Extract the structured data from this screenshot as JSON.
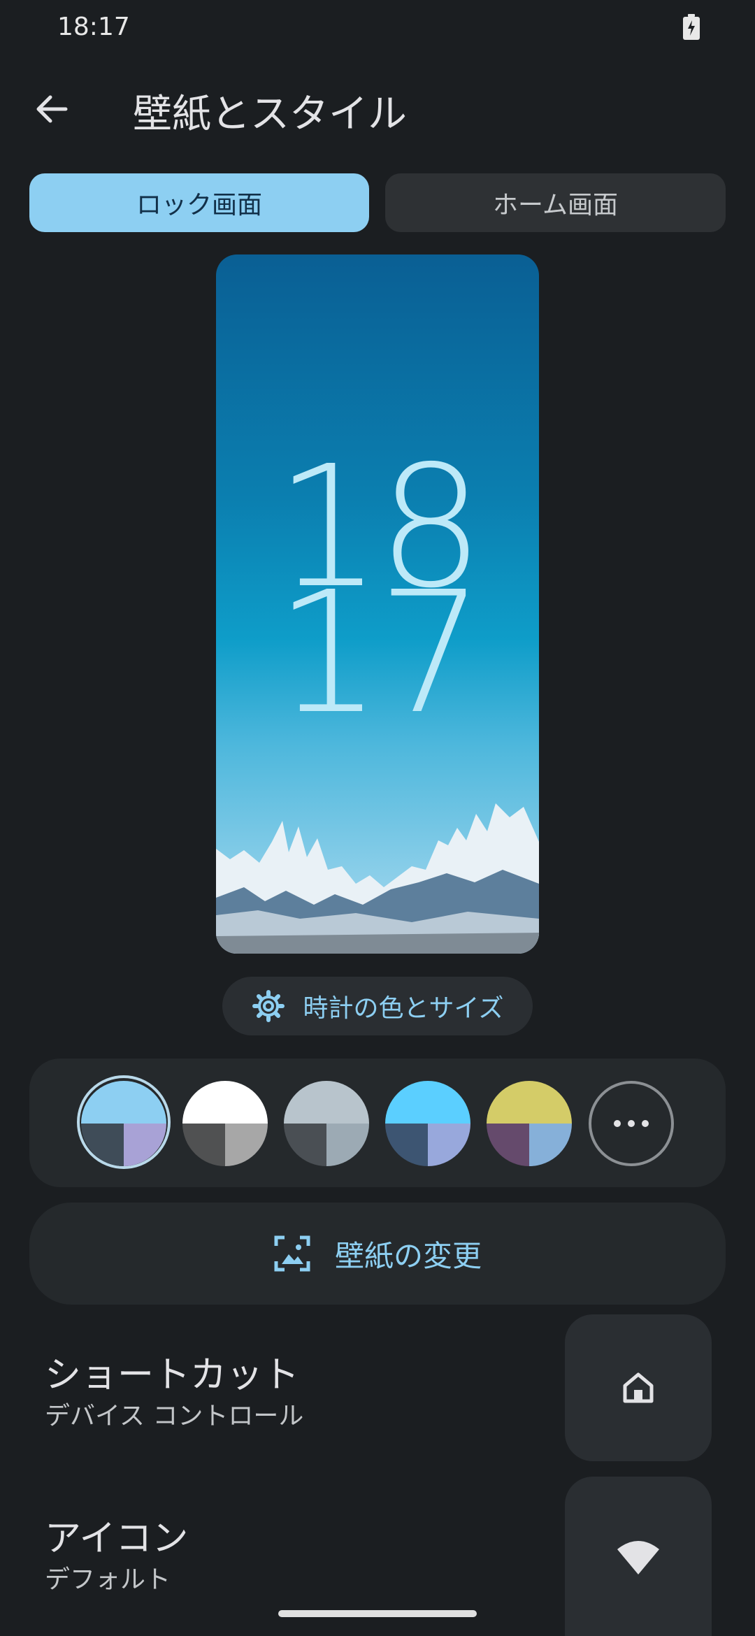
{
  "status_bar": {
    "time": "18:17"
  },
  "header": {
    "title": "壁紙とスタイル"
  },
  "tabs": [
    {
      "label": "ロック画面",
      "selected": true
    },
    {
      "label": "ホーム画面",
      "selected": false
    }
  ],
  "preview": {
    "clock_hour": "18",
    "clock_minute": "17"
  },
  "clock_settings": {
    "label": "時計の色とサイズ",
    "icon": "gear-icon"
  },
  "palette": {
    "selected_index": 0,
    "swatches": [
      {
        "top": "#8dcff2",
        "bottom_left": "#3f4c58",
        "bottom_right": "#a8a2d6"
      },
      {
        "top": "#ffffff",
        "bottom_left": "#505152",
        "bottom_right": "#a7a7a7"
      },
      {
        "top": "#b8c4cc",
        "bottom_left": "#4a4f54",
        "bottom_right": "#9caab4"
      },
      {
        "top": "#5bcfff",
        "bottom_left": "#3d5572",
        "bottom_right": "#98a8dc"
      },
      {
        "top": "#d4cc68",
        "bottom_left": "#654a6c",
        "bottom_right": "#86b0d9"
      }
    ],
    "more_icon": "more-horizontal-icon"
  },
  "change_wallpaper": {
    "label": "壁紙の変更",
    "icon": "wallpaper-icon"
  },
  "shortcuts": {
    "title": "ショートカット",
    "subtitle": "デバイス コントロール",
    "icon": "home-icon"
  },
  "icons": {
    "title": "アイコン",
    "subtitle": "デフォルト",
    "icon": "wifi-icon"
  },
  "colors": {
    "accent": "#8dcff2",
    "background": "#1b1e21",
    "surface": "#25292c"
  }
}
